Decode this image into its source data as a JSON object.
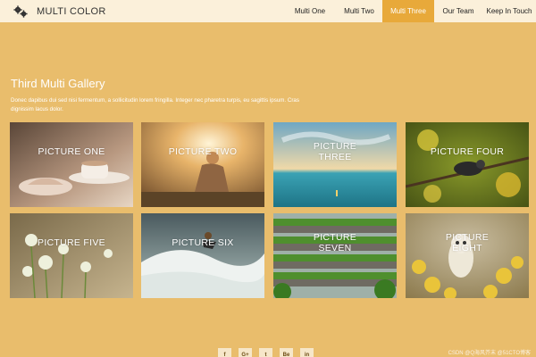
{
  "header": {
    "brand": "MULTI COLOR",
    "nav": [
      {
        "label": "Multi One"
      },
      {
        "label": "Multi Two"
      },
      {
        "label": "Multi Three",
        "active": true
      },
      {
        "label": "Our Team"
      },
      {
        "label": "Keep In Touch"
      }
    ]
  },
  "section": {
    "title": "Third Multi Gallery",
    "description": "Donec dapibus dui sed nisi fermentum, a sollicitudin lorem fringilla. Integer nec pharetra turpis, eu sagittis ipsum. Cras dignissim lacus dolor."
  },
  "gallery": [
    {
      "caption": "PICTURE ONE"
    },
    {
      "caption": "PICTURE TWO"
    },
    {
      "caption_line1": "PICTURE",
      "caption_line2": "THREE"
    },
    {
      "caption": "PICTURE FOUR"
    },
    {
      "caption": "PICTURE FIVE"
    },
    {
      "caption": "PICTURE SIX"
    },
    {
      "caption_line1": "PICTURE",
      "caption_line2": "SEVEN"
    },
    {
      "caption_line1": "PICTURE",
      "caption_line2": "EIGHT"
    }
  ],
  "footer": {
    "social": [
      "f",
      "G+",
      "t",
      "Be",
      "in"
    ],
    "watermark": "CSDN @Q海风芥末 @51CTO博客"
  },
  "colors": {
    "background": "#e9bd6c",
    "topbar": "#fbf0da",
    "active_nav": "#e8a93a"
  }
}
